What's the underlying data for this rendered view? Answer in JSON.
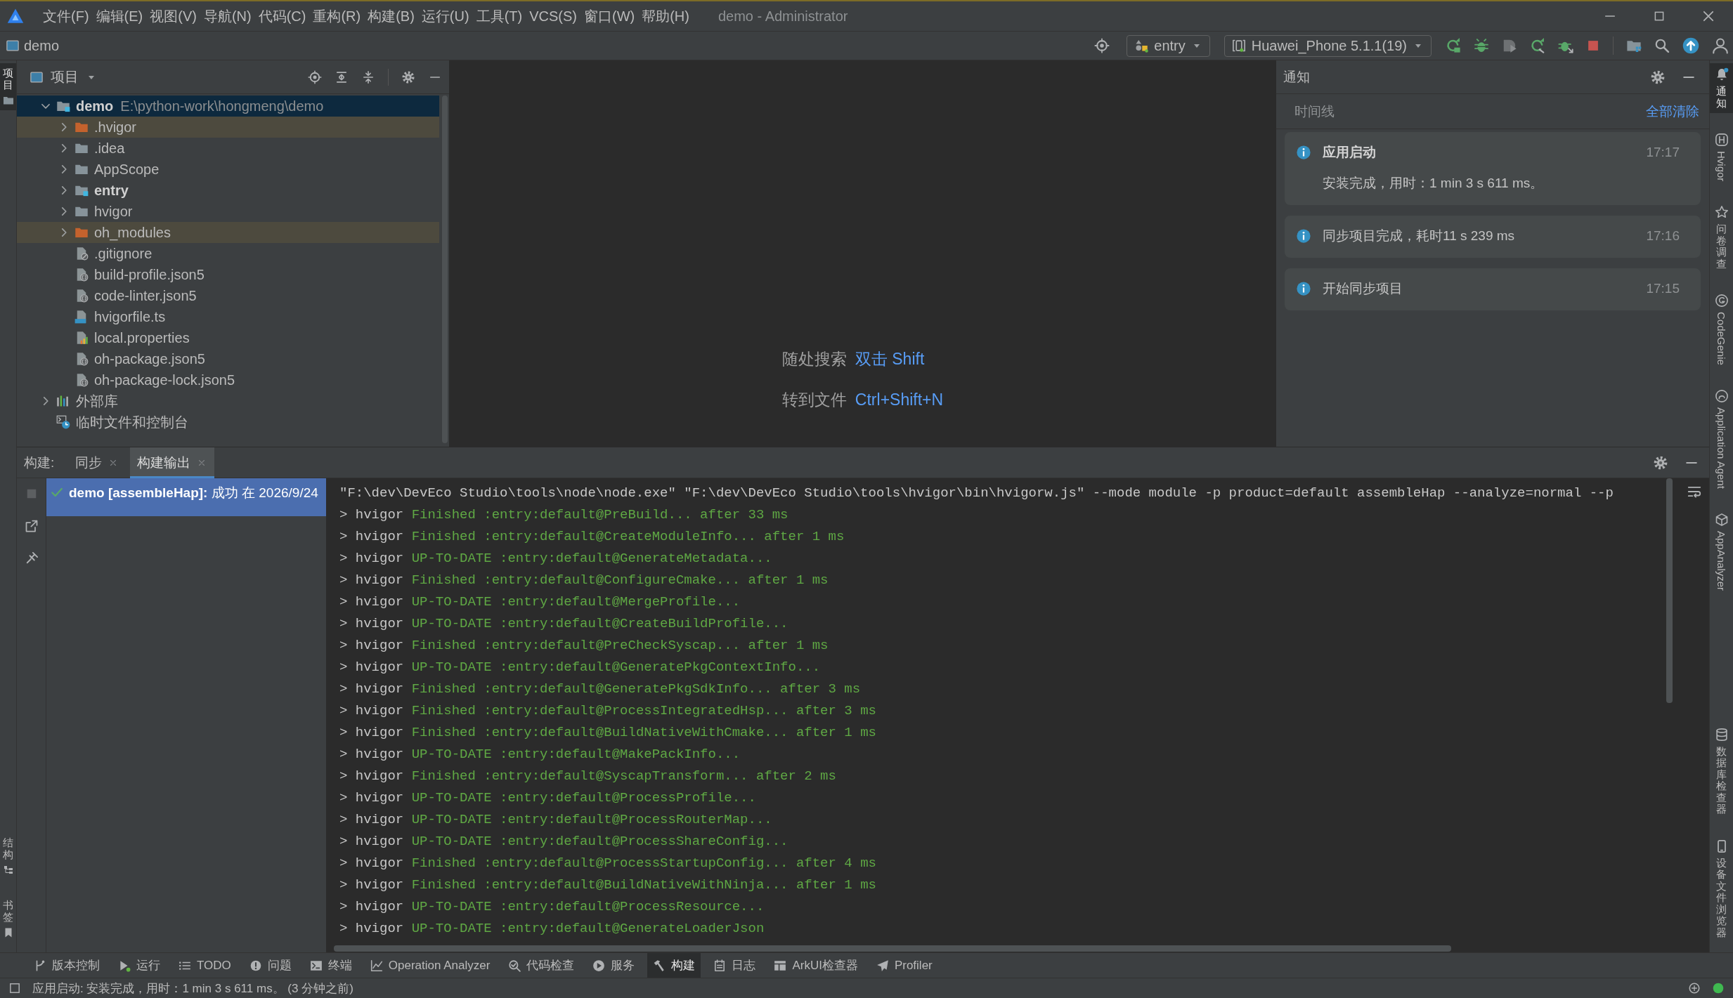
{
  "title_bar": {
    "menu": [
      "文件(F)",
      "编辑(E)",
      "视图(V)",
      "导航(N)",
      "代码(C)",
      "重构(R)",
      "构建(B)",
      "运行(U)",
      "工具(T)",
      "VCS(S)",
      "窗口(W)",
      "帮助(H)"
    ],
    "title": "demo - Administrator"
  },
  "nav_bar": {
    "project": "demo",
    "run_config": "entry",
    "device": "Huawei_Phone 5.1.1(19)"
  },
  "left_strip": {
    "top": [
      {
        "label": "项目",
        "kind": "project",
        "selected": true
      }
    ],
    "bottom": [
      {
        "label": "结构",
        "kind": "structure",
        "selected": false
      },
      {
        "label": "书签",
        "kind": "bookmark",
        "selected": false
      }
    ]
  },
  "project_panel": {
    "title": "项目",
    "tree": [
      {
        "name": "demo",
        "path": "E:\\python-work\\hongmeng\\demo",
        "kind": "module",
        "expanded": true,
        "selected": true,
        "children": [
          {
            "name": ".hvigor",
            "kind": "excluded",
            "expanded": false,
            "selected": false
          },
          {
            "name": ".idea",
            "kind": "folder",
            "expanded": false,
            "selected": false
          },
          {
            "name": "AppScope",
            "kind": "folder",
            "expanded": false,
            "selected": false
          },
          {
            "name": "entry",
            "kind": "module",
            "expanded": false,
            "selected": false
          },
          {
            "name": "hvigor",
            "kind": "folder",
            "expanded": false,
            "selected": false
          },
          {
            "name": "oh_modules",
            "kind": "excluded",
            "expanded": false,
            "selected": false
          },
          {
            "name": ".gitignore",
            "kind": "ignore-file",
            "selected": false
          },
          {
            "name": "build-profile.json5",
            "kind": "json-file",
            "selected": false
          },
          {
            "name": "code-linter.json5",
            "kind": "json-file",
            "selected": false
          },
          {
            "name": "hvigorfile.ts",
            "kind": "ts-file",
            "selected": false
          },
          {
            "name": "local.properties",
            "kind": "properties-file",
            "selected": false
          },
          {
            "name": "oh-package.json5",
            "kind": "json-file",
            "selected": false
          },
          {
            "name": "oh-package-lock.json5",
            "kind": "json-file",
            "selected": false
          }
        ]
      },
      {
        "name": "外部库",
        "kind": "library",
        "expanded": false,
        "selected": false
      },
      {
        "name": "临时文件和控制台",
        "kind": "scratch",
        "selected": false
      }
    ]
  },
  "editor": {
    "hints": [
      {
        "action": "随处搜索",
        "shortcut": "双击 Shift"
      },
      {
        "action": "转到文件",
        "shortcut": "Ctrl+Shift+N"
      }
    ]
  },
  "notifications": {
    "title": "通知",
    "timeline_label": "时间线",
    "clear_all": "全部清除",
    "items": [
      {
        "title": "应用启动",
        "text": "安装完成，用时：1 min 3 s 611 ms。",
        "time": "17:17"
      },
      {
        "text": "同步项目完成，耗时11 s 239 ms",
        "time": "17:16"
      },
      {
        "text": "开始同步项目",
        "time": "17:15"
      }
    ]
  },
  "right_strip": {
    "top": [
      {
        "label": "通知",
        "kind": "bell",
        "selected": true
      },
      {
        "label": "Hvigor",
        "kind": "hvigor",
        "selected": false
      },
      {
        "label": "问卷调查",
        "kind": "survey",
        "selected": false
      },
      {
        "label": "CodeGenie",
        "kind": "codegenie",
        "selected": false
      },
      {
        "label": "Application Agent",
        "kind": "agent",
        "selected": false
      },
      {
        "label": "AppAnalyzer",
        "kind": "analyzer",
        "selected": false
      }
    ],
    "bottom": [
      {
        "label": "数据库检查器",
        "kind": "database",
        "selected": false
      },
      {
        "label": "设备文件浏览器",
        "kind": "device",
        "selected": false
      }
    ]
  },
  "build_panel": {
    "label": "构建:",
    "tabs": [
      {
        "label": "同步",
        "selected": false
      },
      {
        "label": "构建输出",
        "selected": true
      }
    ],
    "tree": [
      {
        "text": "**demo [assembleHap]:** 成功 在 2026/9/24",
        "succeeded": true,
        "selected": true
      }
    ],
    "console": [
      {
        "kind": "command",
        "text": "\"F:\\dev\\DevEco Studio\\tools\\node\\node.exe\" \"F:\\dev\\DevEco Studio\\tools\\hvigor\\bin\\hvigorw.js\" --mode module -p product=default assembleHap --analyze=normal --p"
      },
      {
        "kind": "task",
        "prefix": "> hvigor",
        "message": "Finished :entry:default@PreBuild... after 33 ms"
      },
      {
        "kind": "task",
        "prefix": "> hvigor",
        "message": "Finished :entry:default@CreateModuleInfo... after 1 ms"
      },
      {
        "kind": "task",
        "prefix": "> hvigor",
        "message": "UP-TO-DATE :entry:default@GenerateMetadata..."
      },
      {
        "kind": "task",
        "prefix": "> hvigor",
        "message": "Finished :entry:default@ConfigureCmake... after 1 ms"
      },
      {
        "kind": "task",
        "prefix": "> hvigor",
        "message": "UP-TO-DATE :entry:default@MergeProfile..."
      },
      {
        "kind": "task",
        "prefix": "> hvigor",
        "message": "UP-TO-DATE :entry:default@CreateBuildProfile..."
      },
      {
        "kind": "task",
        "prefix": "> hvigor",
        "message": "Finished :entry:default@PreCheckSyscap... after 1 ms"
      },
      {
        "kind": "task",
        "prefix": "> hvigor",
        "message": "UP-TO-DATE :entry:default@GeneratePkgContextInfo..."
      },
      {
        "kind": "task",
        "prefix": "> hvigor",
        "message": "Finished :entry:default@GeneratePkgSdkInfo... after 3 ms"
      },
      {
        "kind": "task",
        "prefix": "> hvigor",
        "message": "Finished :entry:default@ProcessIntegratedHsp... after 3 ms"
      },
      {
        "kind": "task",
        "prefix": "> hvigor",
        "message": "Finished :entry:default@BuildNativeWithCmake... after 1 ms"
      },
      {
        "kind": "task",
        "prefix": "> hvigor",
        "message": "UP-TO-DATE :entry:default@MakePackInfo..."
      },
      {
        "kind": "task",
        "prefix": "> hvigor",
        "message": "Finished :entry:default@SyscapTransform... after 2 ms"
      },
      {
        "kind": "task",
        "prefix": "> hvigor",
        "message": "UP-TO-DATE :entry:default@ProcessProfile..."
      },
      {
        "kind": "task",
        "prefix": "> hvigor",
        "message": "UP-TO-DATE :entry:default@ProcessRouterMap..."
      },
      {
        "kind": "task",
        "prefix": "> hvigor",
        "message": "UP-TO-DATE :entry:default@ProcessShareConfig..."
      },
      {
        "kind": "task",
        "prefix": "> hvigor",
        "message": "Finished :entry:default@ProcessStartupConfig... after 4 ms"
      },
      {
        "kind": "task",
        "prefix": "> hvigor",
        "message": "Finished :entry:default@BuildNativeWithNinja... after 1 ms"
      },
      {
        "kind": "task",
        "prefix": "> hvigor",
        "message": "UP-TO-DATE :entry:default@ProcessResource..."
      },
      {
        "kind": "task",
        "prefix": "> hvigor",
        "message": "UP-TO-DATE :entry:default@GenerateLoaderJson"
      }
    ]
  },
  "tool_bar": [
    {
      "label": "版本控制",
      "kind": "vcs",
      "selected": false
    },
    {
      "label": "运行",
      "kind": "run",
      "selected": false
    },
    {
      "label": "TODO",
      "kind": "todo",
      "selected": false
    },
    {
      "label": "问题",
      "kind": "problems",
      "selected": false
    },
    {
      "label": "终端",
      "kind": "terminal",
      "selected": false
    },
    {
      "label": "Operation Analyzer",
      "kind": "analyzer",
      "selected": false
    },
    {
      "label": "代码检查",
      "kind": "inspect",
      "selected": false
    },
    {
      "label": "服务",
      "kind": "services",
      "selected": false
    },
    {
      "label": "构建",
      "kind": "build",
      "selected": true
    },
    {
      "label": "日志",
      "kind": "log",
      "selected": false
    },
    {
      "label": "ArkUI检查器",
      "kind": "arkui",
      "selected": false
    },
    {
      "label": "Profiler",
      "kind": "profiler",
      "selected": false
    }
  ],
  "status_bar": {
    "message": "应用启动: 安装完成，用时：1 min 3 s 611 ms。 (3 分钟之前)"
  }
}
